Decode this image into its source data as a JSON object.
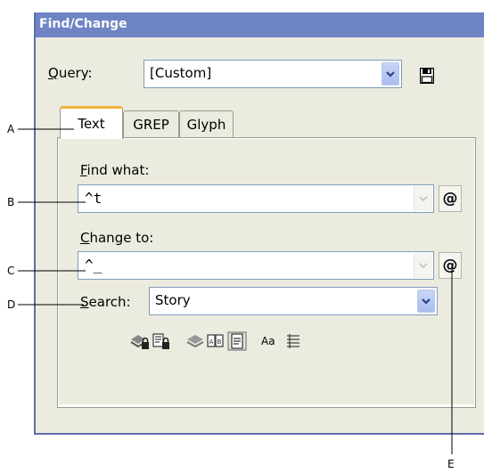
{
  "window": {
    "title": "Find/Change"
  },
  "query": {
    "label_u": "Q",
    "label_rest": "uery:",
    "value": "[Custom]"
  },
  "tabs": [
    {
      "label": "Text"
    },
    {
      "label": "GREP"
    },
    {
      "label": "Glyph"
    }
  ],
  "find": {
    "label_u": "F",
    "label_rest": "ind what:",
    "value": "^t"
  },
  "change": {
    "label_u": "C",
    "label_rest": "hange to:",
    "value": "^_"
  },
  "search": {
    "label_u": "S",
    "label_rest": "earch:",
    "value": "Story"
  },
  "at_symbol": "@",
  "options": {
    "case_label": "Aa"
  },
  "callouts": {
    "a": "A",
    "b": "B",
    "c": "C",
    "d": "D",
    "e": "E"
  },
  "colors": {
    "title_bar": "#6e84c4",
    "dialog_bg": "#ecebe0",
    "active_tab_accent": "#f2b33d"
  }
}
